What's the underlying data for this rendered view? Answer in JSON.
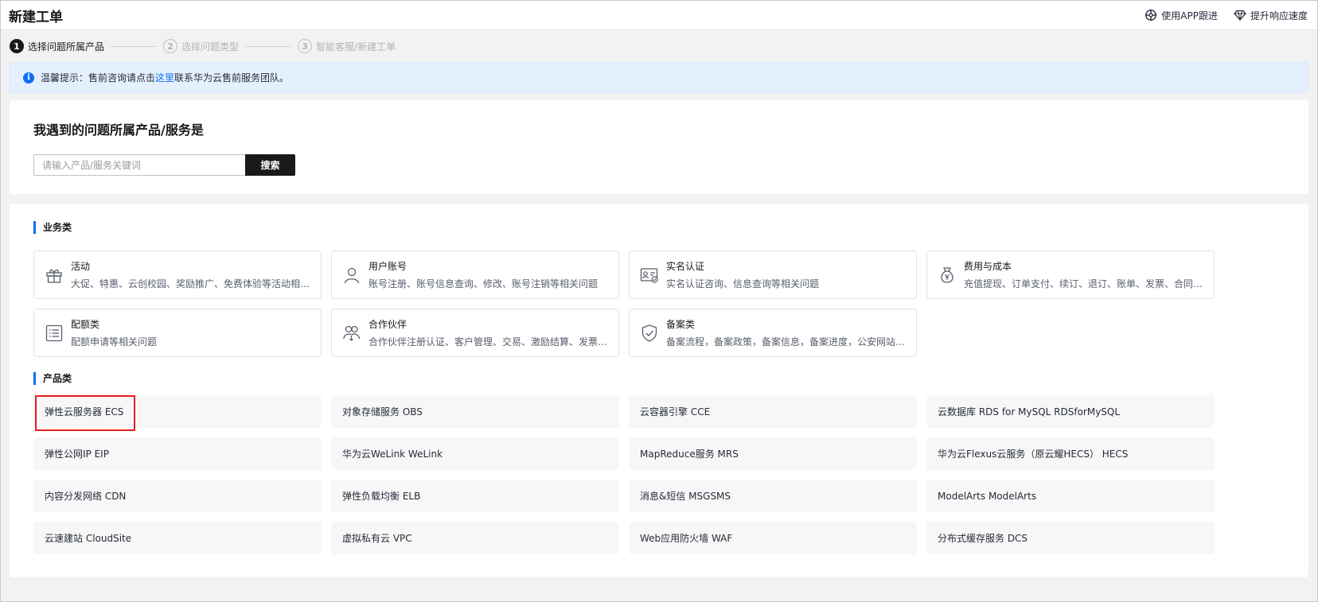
{
  "header": {
    "title": "新建工单",
    "actions": [
      {
        "label": "使用APP跟进",
        "icon": "app-track-icon"
      },
      {
        "label": "提升响应速度",
        "icon": "diamond-icon"
      }
    ]
  },
  "steps": [
    {
      "num": "1",
      "label": "选择问题所属产品",
      "state": "active"
    },
    {
      "num": "2",
      "label": "选择问题类型",
      "state": "inactive"
    },
    {
      "num": "3",
      "label": "智能客服/新建工单",
      "state": "inactive"
    }
  ],
  "notice": {
    "prefix": "温馨提示：售前咨询请点击",
    "link": "这里",
    "suffix": "联系华为云售前服务团队。"
  },
  "search": {
    "title": "我遇到的问题所属产品/服务是",
    "placeholder": "请输入产品/服务关键词",
    "button": "搜索"
  },
  "business": {
    "heading": "业务类",
    "items": [
      {
        "title": "活动",
        "desc": "大促、特惠、云创校园、奖励推广、免费体验等活动相关问题",
        "icon": "gift-icon"
      },
      {
        "title": "用户账号",
        "desc": "账号注册、账号信息查询、修改、账号注销等相关问题",
        "icon": "user-icon"
      },
      {
        "title": "实名认证",
        "desc": "实名认证咨询、信息查询等相关问题",
        "icon": "id-card-icon"
      },
      {
        "title": "费用与成本",
        "desc": "充值提现、订单支付、续订、退订、账单、发票、合同、优惠券等相关问题",
        "icon": "money-bag-icon"
      },
      {
        "title": "配额类",
        "desc": "配额申请等相关问题",
        "icon": "list-icon"
      },
      {
        "title": "合作伙伴",
        "desc": "合作伙伴注册认证、客户管理、交易、激励结算、发票等相关问题",
        "icon": "partner-icon"
      },
      {
        "title": "备案类",
        "desc": "备案流程，备案政策，备案信息，备案进度，公安网站备案等相关问题",
        "icon": "shield-check-icon"
      }
    ]
  },
  "products": {
    "heading": "产品类",
    "items": [
      "弹性云服务器 ECS",
      "对象存储服务 OBS",
      "云容器引擎 CCE",
      "云数据库 RDS for MySQL RDSforMySQL",
      "弹性公网IP EIP",
      "华为云WeLink WeLink",
      "MapReduce服务 MRS",
      "华为云Flexus云服务（原云耀HECS） HECS",
      "内容分发网络 CDN",
      "弹性负载均衡 ELB",
      "消息&短信 MSGSMS",
      "ModelArts ModelArts",
      "云速建站 CloudSite",
      "虚拟私有云 VPC",
      "Web应用防火墙 WAF",
      "分布式缓存服务 DCS"
    ]
  },
  "colors": {
    "accent": "#0d6ef3",
    "highlight": "#e02020",
    "dark": "#191919"
  }
}
